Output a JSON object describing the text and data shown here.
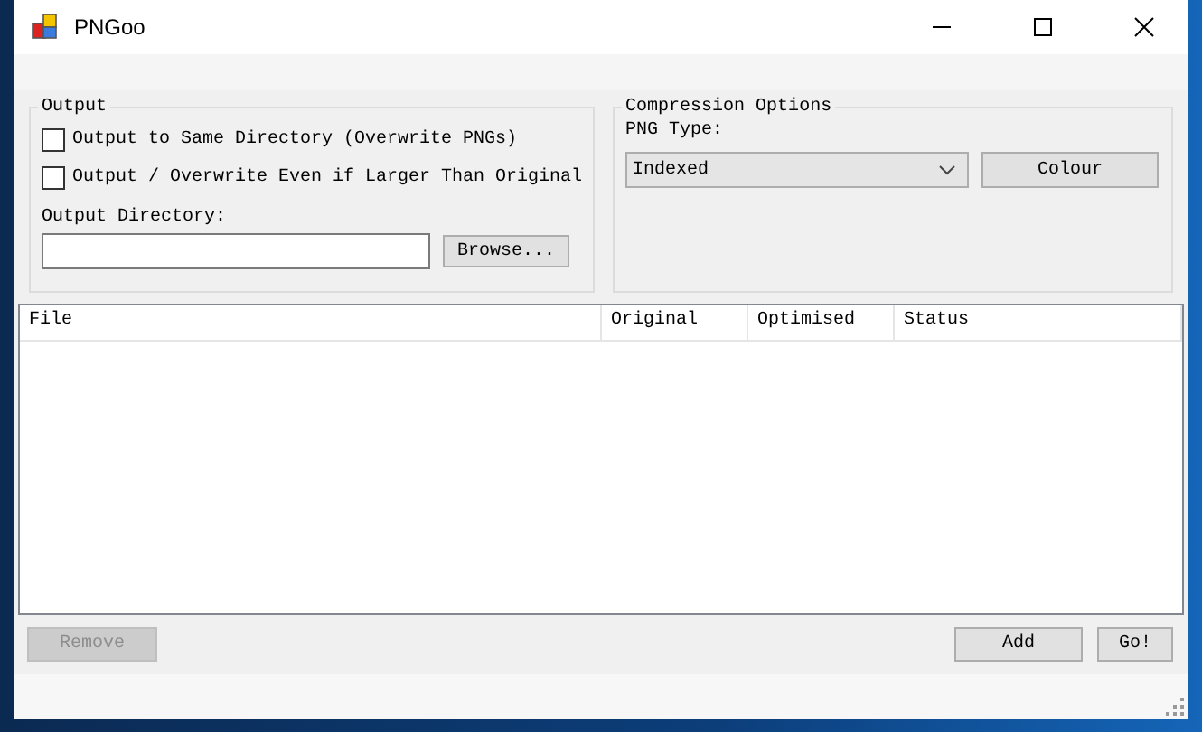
{
  "window": {
    "title": "PNGoo"
  },
  "output": {
    "legend": "Output",
    "checkboxes": [
      {
        "label": "Output to Same Directory (Overwrite PNGs)",
        "checked": false
      },
      {
        "label": "Output / Overwrite Even if Larger Than Original",
        "checked": false
      }
    ],
    "directory_label": "Output Directory:",
    "browse_button": "Browse..."
  },
  "compression": {
    "legend": "Compression Options",
    "png_type_label": "PNG Type:",
    "png_type": "Indexed",
    "colour_button": "Colour"
  },
  "table": {
    "columns": [
      "File",
      "Original",
      "Optimised",
      "Status"
    ]
  },
  "buttons": [
    {
      "label": "Remove",
      "disabled": true
    },
    {
      "label": "Add",
      "disabled": false
    },
    {
      "label": "Go!",
      "disabled": false
    }
  ]
}
